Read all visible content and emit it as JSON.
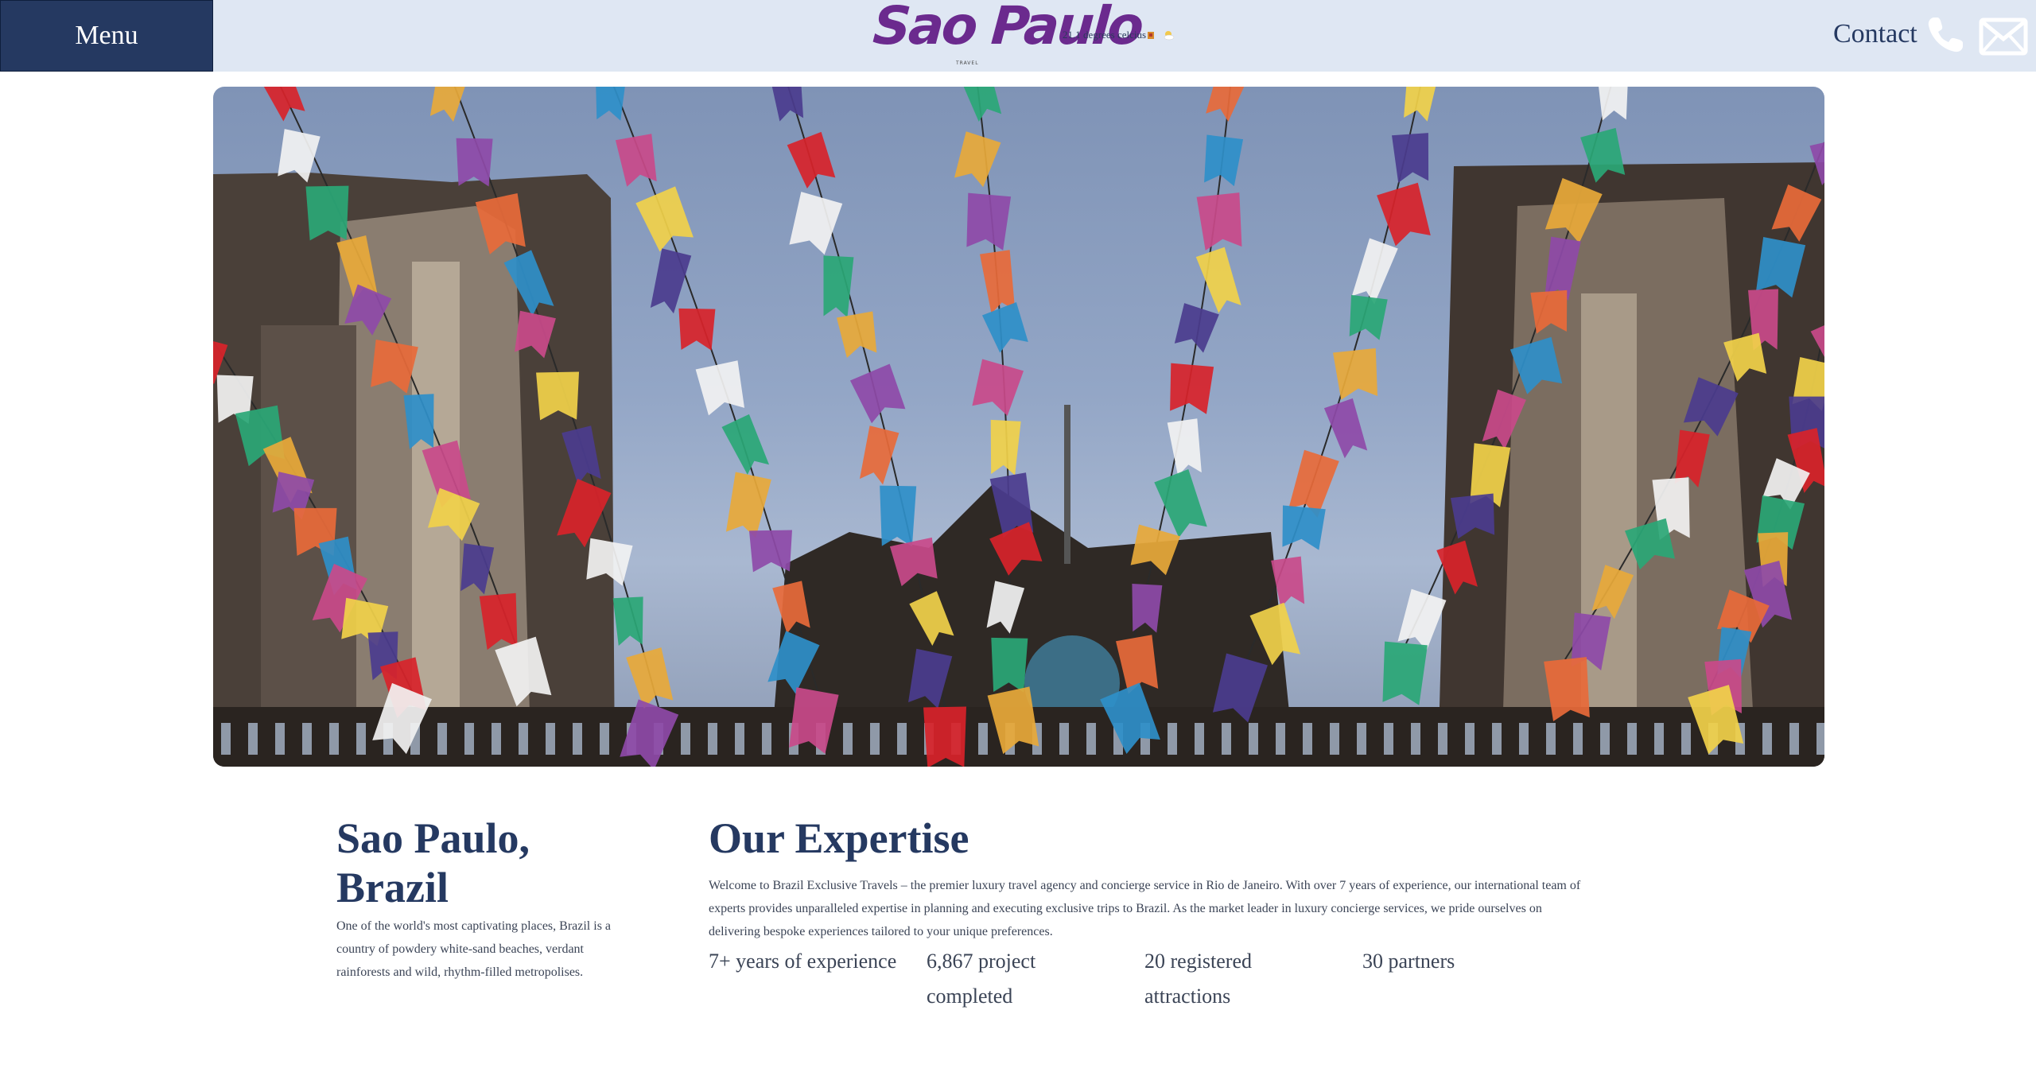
{
  "header": {
    "menu_label": "Menu",
    "logo_text": "Sao Paulo",
    "logo_sub": "TRAVEL",
    "weather_text": "21.1 degrees celcius",
    "contact_label": "Contact"
  },
  "icons": {
    "weather": "weather-sun-cloud-icon",
    "phone": "phone-icon",
    "mail": "mail-icon"
  },
  "colors": {
    "navy": "#253961",
    "header_bg": "#dfe7f3",
    "logo_purple": "#6b2a8e"
  },
  "hero": {
    "alt": "Colorful papel picado banners strung between old stone buildings under a blue sky"
  },
  "city": {
    "title": "Sao Paulo, Brazil",
    "description": "One of the world's most captivating places, Brazil is a country of powdery white-sand beaches, verdant rainforests and wild, rhythm-filled metropolises."
  },
  "expertise": {
    "title": "Our Expertise",
    "description": "Welcome to Brazil Exclusive Travels – the premier luxury travel agency and concierge service in Rio de Janeiro. With over 7 years of experience, our international team of experts provides unparalleled expertise in planning and executing exclusive trips to Brazil. As the market leader in luxury concierge services, we pride ourselves on delivering bespoke experiences tailored to your unique preferences.",
    "stats": [
      {
        "text": "7+ years of experience"
      },
      {
        "text": "6,867 project completed"
      },
      {
        "text": "20 registered attractions"
      },
      {
        "text": "30 partners"
      }
    ]
  }
}
